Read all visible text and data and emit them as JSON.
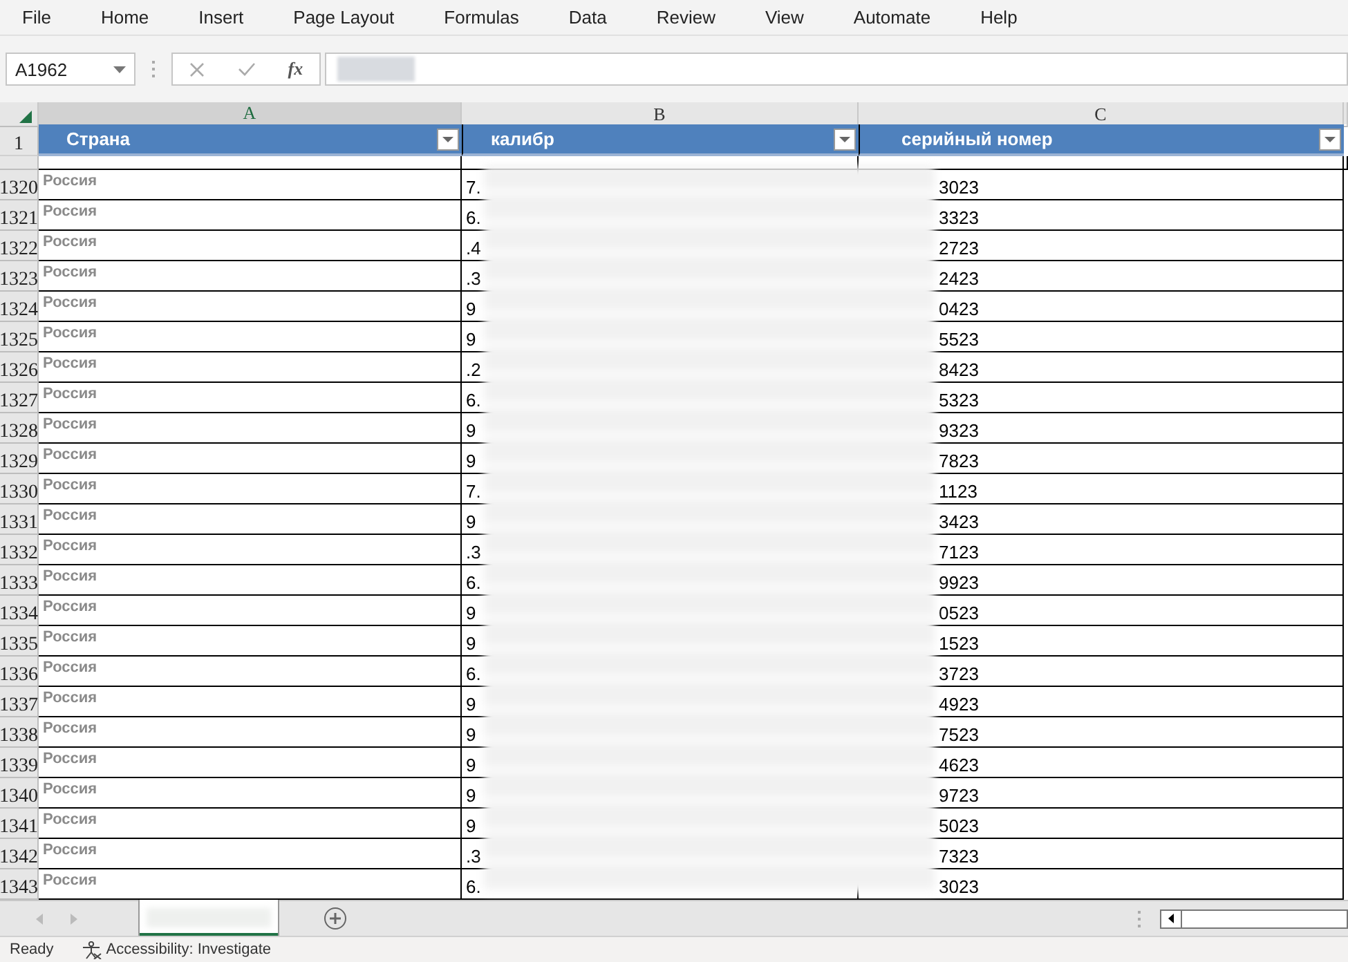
{
  "menu": [
    {
      "label": "File"
    },
    {
      "label": "Home"
    },
    {
      "label": "Insert"
    },
    {
      "label": "Page Layout"
    },
    {
      "label": "Formulas"
    },
    {
      "label": "Data"
    },
    {
      "label": "Review"
    },
    {
      "label": "View"
    },
    {
      "label": "Automate"
    },
    {
      "label": "Help"
    }
  ],
  "name_box": {
    "value": "A1962"
  },
  "formula_bar": {
    "function_label": "fx"
  },
  "columns": [
    {
      "letter": "A",
      "header": "Страна",
      "selected": true
    },
    {
      "letter": "B",
      "header": "калибр",
      "selected": false
    },
    {
      "letter": "C",
      "header": "серийный номер",
      "selected": false
    }
  ],
  "header_row_number": "1",
  "rows": [
    {
      "number": "1320",
      "cells": [
        "Россия",
        "7.",
        "3023"
      ]
    },
    {
      "number": "1321",
      "cells": [
        "Россия",
        "6.",
        "3323"
      ]
    },
    {
      "number": "1322",
      "cells": [
        "Россия",
        ".4",
        "2723"
      ]
    },
    {
      "number": "1323",
      "cells": [
        "Россия",
        ".3",
        "2423"
      ]
    },
    {
      "number": "1324",
      "cells": [
        "Россия",
        "9",
        "0423"
      ]
    },
    {
      "number": "1325",
      "cells": [
        "Россия",
        "9",
        "5523"
      ]
    },
    {
      "number": "1326",
      "cells": [
        "Россия",
        ".2",
        "8423"
      ]
    },
    {
      "number": "1327",
      "cells": [
        "Россия",
        "6.",
        "5323"
      ]
    },
    {
      "number": "1328",
      "cells": [
        "Россия",
        "9",
        "9323"
      ]
    },
    {
      "number": "1329",
      "cells": [
        "Россия",
        "9",
        "7823"
      ]
    },
    {
      "number": "1330",
      "cells": [
        "Россия",
        "7.",
        "1123"
      ]
    },
    {
      "number": "1331",
      "cells": [
        "Россия",
        "9",
        "3423"
      ]
    },
    {
      "number": "1332",
      "cells": [
        "Россия",
        ".3",
        "7123"
      ]
    },
    {
      "number": "1333",
      "cells": [
        "Россия",
        "6.",
        "9923"
      ]
    },
    {
      "number": "1334",
      "cells": [
        "Россия",
        "9",
        "0523"
      ]
    },
    {
      "number": "1335",
      "cells": [
        "Россия",
        "9",
        "1523"
      ]
    },
    {
      "number": "1336",
      "cells": [
        "Россия",
        "6.",
        "3723"
      ]
    },
    {
      "number": "1337",
      "cells": [
        "Россия",
        "9",
        "4923"
      ]
    },
    {
      "number": "1338",
      "cells": [
        "Россия",
        "9",
        "7523"
      ]
    },
    {
      "number": "1339",
      "cells": [
        "Россия",
        "9",
        "4623"
      ]
    },
    {
      "number": "1340",
      "cells": [
        "Россия",
        "9",
        "9723"
      ]
    },
    {
      "number": "1341",
      "cells": [
        "Россия",
        "9",
        "5023"
      ]
    },
    {
      "number": "1342",
      "cells": [
        "Россия",
        ".3",
        "7323"
      ]
    },
    {
      "number": "1343",
      "cells": [
        "Россия",
        "6.",
        "3023"
      ]
    }
  ],
  "status_bar": {
    "mode": "Ready",
    "accessibility": "Accessibility: Investigate"
  }
}
